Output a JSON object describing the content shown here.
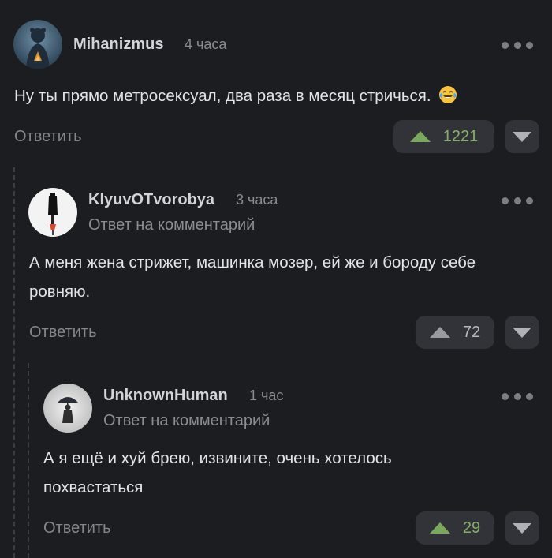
{
  "comments": [
    {
      "username": "Mihanizmus",
      "time": "4 часа",
      "text": "Ну ты прямо метросексуал, два раза в месяц стричься.",
      "emoji": "tears-of-joy-emoji",
      "reply_label": "Ответить",
      "votes": "1221",
      "vote_state": "upvoted"
    },
    {
      "username": "KlyuvOTvorobya",
      "time": "3 часа",
      "reply_note": "Ответ на комментарий",
      "text": "А меня жена стрижет, машинка мозер, ей же и бороду себе ровняю.",
      "reply_label": "Ответить",
      "votes": "72",
      "vote_state": "neutral"
    },
    {
      "username": "UnknownHuman",
      "time": "1 час",
      "reply_note": "Ответ на комментарий",
      "text": "А я ещё и хуй брею, извините, очень хотелось похвастаться",
      "reply_label": "Ответить",
      "votes": "29",
      "vote_state": "upvoted"
    }
  ],
  "colors": {
    "background": "#1c1d20",
    "upvote_active": "#7aa85c",
    "button_bg": "#323338"
  }
}
